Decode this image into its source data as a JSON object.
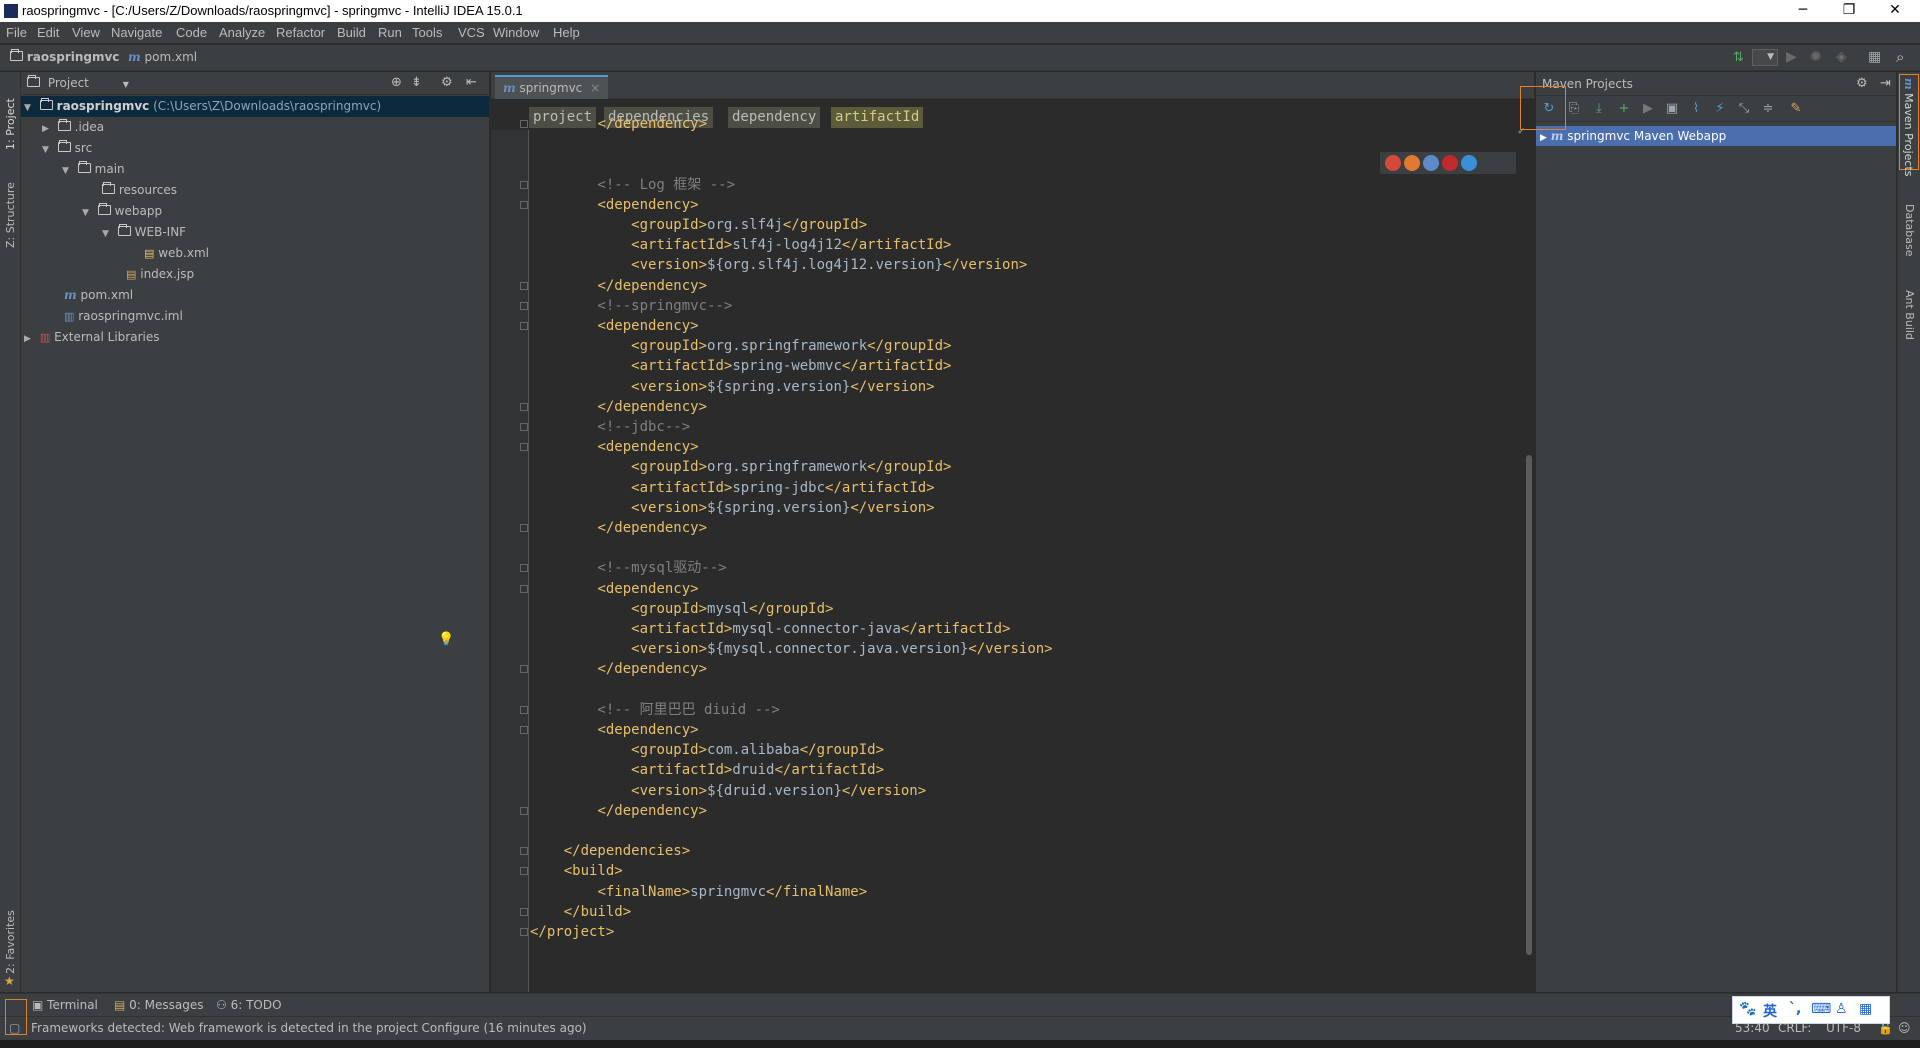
{
  "window": {
    "title": "raospringmvc - [C:/Users/Z/Downloads/raospringmvc] - springmvc - IntelliJ IDEA 15.0.1"
  },
  "menu": [
    "File",
    "Edit",
    "View",
    "Navigate",
    "Code",
    "Analyze",
    "Refactor",
    "Build",
    "Run",
    "Tools",
    "VCS",
    "Window",
    "Help"
  ],
  "navbar": {
    "project": "raospringmvc",
    "file": "pom.xml"
  },
  "left_strip": {
    "project_tab": "1: Project",
    "structure_tab": "Z: Structure",
    "favorites_tab": "2: Favorites"
  },
  "project_panel": {
    "header": "Project",
    "root_name": "raospringmvc",
    "root_path": "(C:\\Users\\Z\\Downloads\\raospringmvc)",
    "items": [
      {
        "label": ".idea"
      },
      {
        "label": "src"
      },
      {
        "label": "main"
      },
      {
        "label": "resources"
      },
      {
        "label": "webapp"
      },
      {
        "label": "WEB-INF"
      },
      {
        "label": "web.xml"
      },
      {
        "label": "index.jsp"
      },
      {
        "label": "pom.xml"
      },
      {
        "label": "raospringmvc.iml"
      },
      {
        "label": "External Libraries"
      }
    ]
  },
  "editor": {
    "tab": "springmvc",
    "breadcrumbs": [
      "project",
      "dependencies",
      "dependency",
      "artifactId"
    ],
    "lines": [
      "        </dependency>",
      "",
      "",
      "        <!-- Log 框架 -->",
      "        <dependency>",
      "            <groupId>org.slf4j</groupId>",
      "            <artifactId>slf4j-log4j12</artifactId>",
      "            <version>${org.slf4j.log4j12.version}</version>",
      "        </dependency>",
      "        <!--springmvc-->",
      "        <dependency>",
      "            <groupId>org.springframework</groupId>",
      "            <artifactId>spring-webmvc</artifactId>",
      "            <version>${spring.version}</version>",
      "        </dependency>",
      "        <!--jdbc-->",
      "        <dependency>",
      "            <groupId>org.springframework</groupId>",
      "            <artifactId>spring-jdbc</artifactId>",
      "            <version>${spring.version}</version>",
      "        </dependency>",
      "",
      "        <!--mysql驱动-->",
      "        <dependency>",
      "            <groupId>mysql</groupId>",
      "            <artifactId>mysql-connector-java</artifactId>",
      "            <version>${mysql.connector.java.version}</version>",
      "        </dependency>",
      "",
      "        <!-- 阿里巴巴 diuid -->",
      "        <dependency>",
      "            <groupId>com.alibaba</groupId>",
      "            <artifactId>druid</artifactId>",
      "            <version>${druid.version}</version>",
      "        </dependency>",
      "",
      "    </dependencies>",
      "    <build>",
      "        <finalName>springmvc</finalName>",
      "    </build>",
      "</project>"
    ]
  },
  "maven_panel": {
    "title": "Maven Projects",
    "project_item": "springmvc Maven Webapp"
  },
  "right_strip": {
    "maven_tab": "Maven Projects",
    "database_tab": "Database",
    "ant_tab": "Ant Build"
  },
  "bottom_tabs": {
    "terminal": "Terminal",
    "messages": "0: Messages",
    "todo": "6: TODO"
  },
  "status": {
    "message": "Frameworks detected: Web framework is detected in the project Configure (16 minutes ago)",
    "position": "53:40",
    "line_sep": "CRLF:",
    "encoding": "UTF-8"
  },
  "ime": {
    "lang": "英"
  },
  "colors": {
    "tag": "#e8bf6a",
    "comment": "#808080",
    "text": "#a9b7c6",
    "selection": "#4b6eaf",
    "highlight": "#e0832e"
  }
}
